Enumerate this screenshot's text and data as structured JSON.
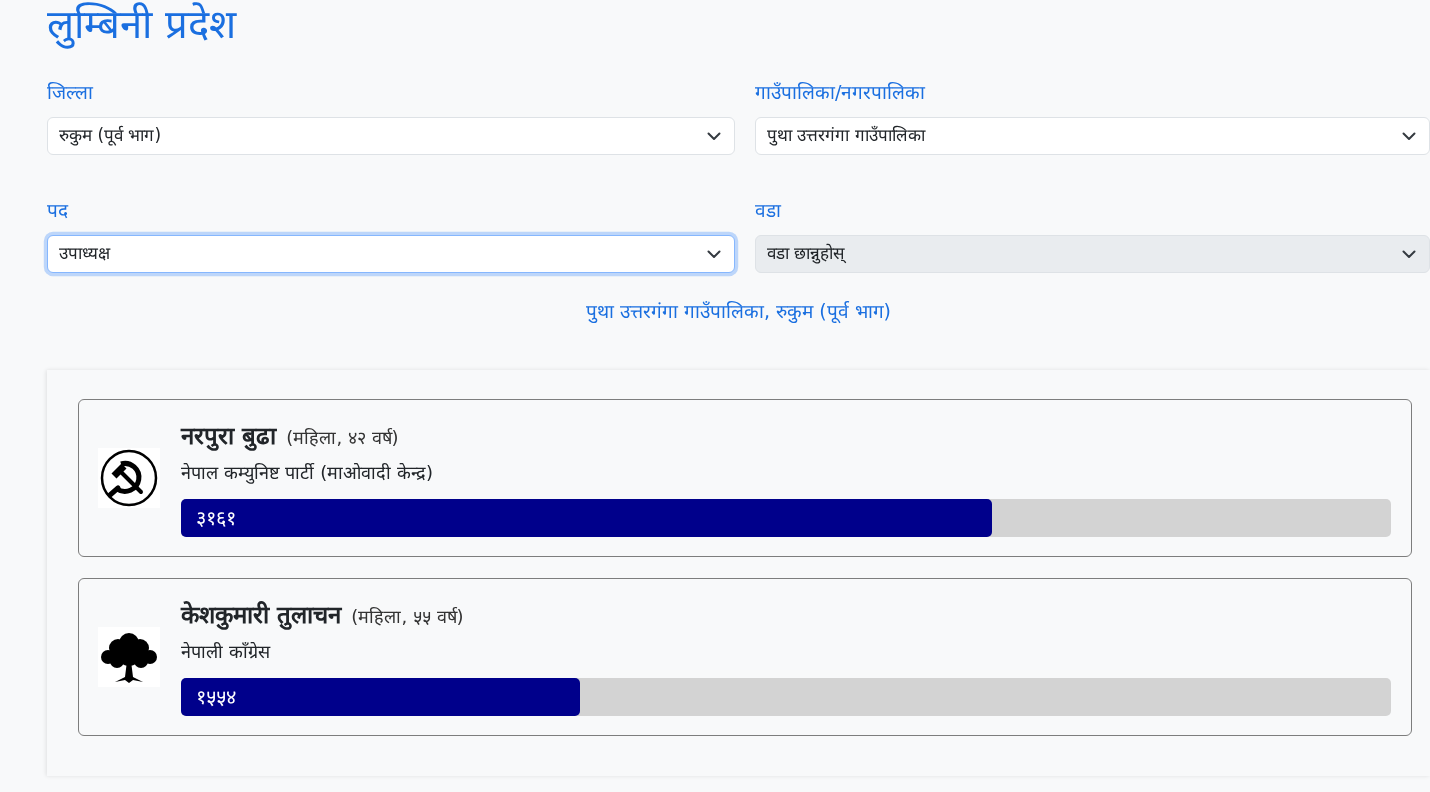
{
  "page": {
    "title": "लुम्बिनी प्रदेश"
  },
  "filters": [
    {
      "label": "जिल्ला",
      "value": "रुकुम (पूर्व भाग)",
      "focused": false,
      "disabled": false
    },
    {
      "label": "गाउँपालिका/नगरपालिका",
      "value": "पुथा उत्तरगंगा गाउँपालिका",
      "focused": false,
      "disabled": false
    },
    {
      "label": "पद",
      "value": "उपाध्यक्ष",
      "focused": true,
      "disabled": false
    },
    {
      "label": "वडा",
      "placeholder": "वडा छान्नुहोस्",
      "focused": false,
      "disabled": true
    }
  ],
  "summary": "पुथा उत्तरगंगा गाउँपालिका, रुकुम (पूर्व भाग)",
  "candidates": [
    {
      "kind": "sickle",
      "name": "नरपुरा बुढा",
      "details": "(महिला, ४२ वर्ष)",
      "party": "नेपाल कम्युनिष्ट पार्टी (माओवादी केन्द्र)",
      "votes": "३१६१",
      "level": 0.6705
    },
    {
      "kind": "tree",
      "name": "केशकुमारी तुलाचन",
      "details": "(महिला, ५५ वर्ष)",
      "party": "नेपाली काँग्रेस",
      "votes": "१५५४",
      "level": 0.3295
    }
  ]
}
